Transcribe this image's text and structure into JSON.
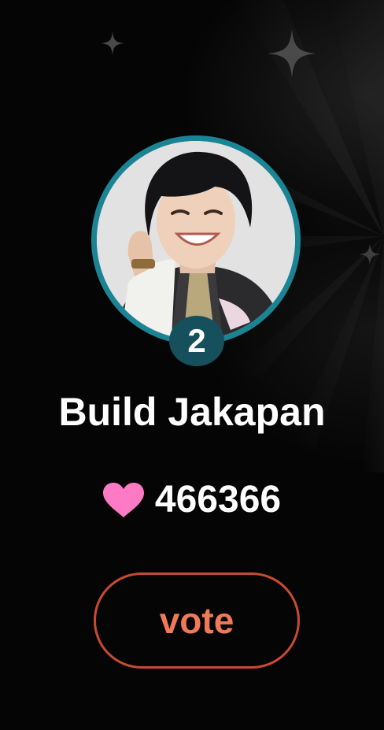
{
  "candidate": {
    "rank": "2",
    "name": "Build Jakapan",
    "votes": "466366",
    "photo_alt": "Build Jakapan"
  },
  "actions": {
    "vote_label": "vote"
  },
  "icons": {
    "heart": "heart-icon",
    "sparkle": "sparkle-icon"
  },
  "colors": {
    "background": "#050505",
    "avatar_ring": "#1a8494",
    "rank_badge": "#15505c",
    "heart": "#ff7ac4",
    "vote_border": "#c84a32",
    "vote_text": "#f07a55"
  }
}
